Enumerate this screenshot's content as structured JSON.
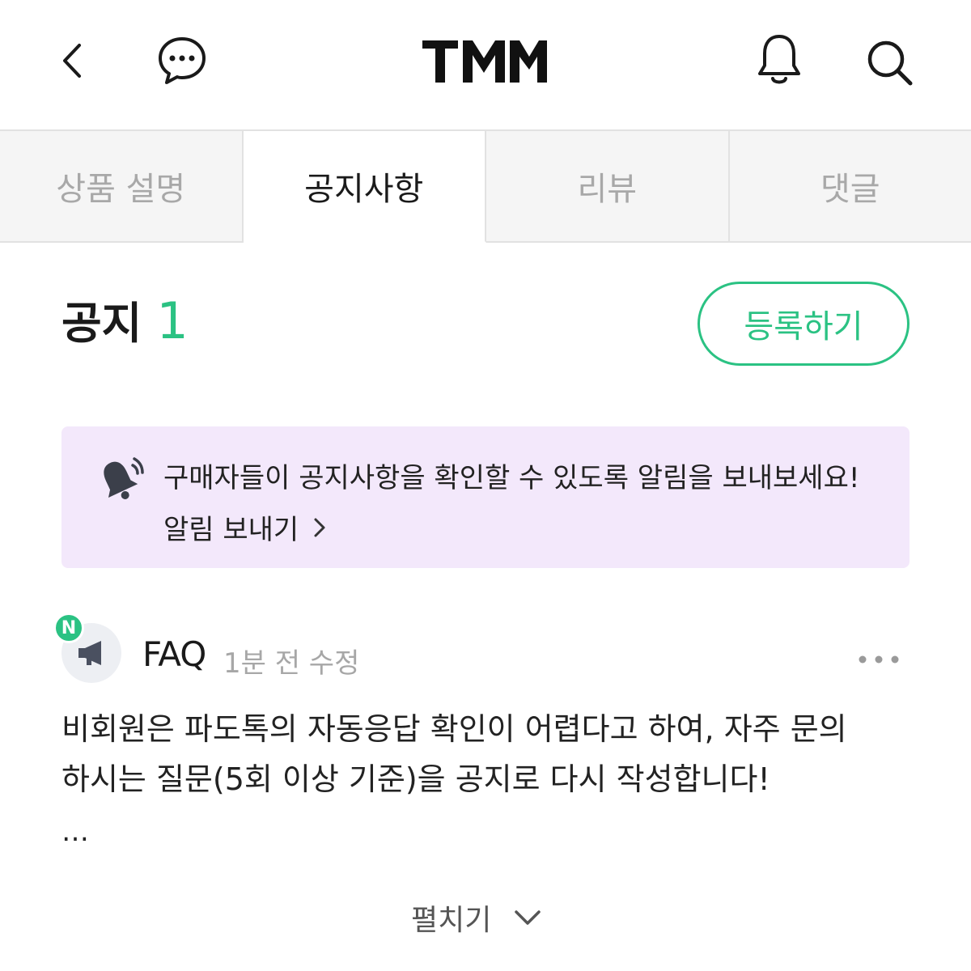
{
  "header": {
    "logo_text": "TMM",
    "icons": [
      "back-icon",
      "chat-bubble-icon",
      "bell-icon",
      "search-icon"
    ]
  },
  "tabs": [
    {
      "label": "상품 설명",
      "active": false
    },
    {
      "label": "공지사항",
      "active": true
    },
    {
      "label": "리뷰",
      "active": false
    },
    {
      "label": "댓글",
      "active": false
    }
  ],
  "notice": {
    "title": "공지",
    "count": "1",
    "register_label": "등록하기"
  },
  "banner": {
    "icon": "megaphone-bell-icon",
    "message": "구매자들이 공지사항을 확인할 수 있도록 알림을 보내보세요!",
    "link_label": "알림 보내기"
  },
  "post": {
    "badge": "N",
    "author": "FAQ",
    "time": "1분 전 수정",
    "body_line1": "비회원은 파도톡의 자동응답 확인이 어렵다고 하여, 자주 문의",
    "body_line2": "하시는 질문(5회 이상 기준)을 공지로 다시 작성합니다!",
    "ellipsis": "…"
  },
  "expand_label": "펼치기",
  "colors": {
    "accent": "#2bc283",
    "banner_bg": "#f3e8fb",
    "tab_inactive_bg": "#f5f5f5"
  }
}
